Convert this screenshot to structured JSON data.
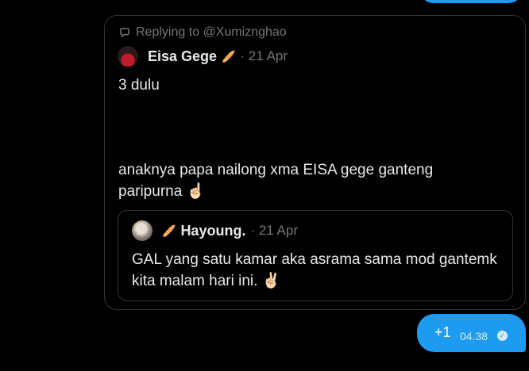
{
  "shared_post": {
    "replying_to": "Replying to @Xumiznghao",
    "author": {
      "name": "Eisa Gege",
      "badge_emoji": "🥖",
      "date": "· 21 Apr"
    },
    "text_line1": "3 dulu",
    "text_line2": " anaknya papa nailong xma EISA gege ganteng paripurna ☝🏻",
    "quoted_post": {
      "badge_emoji": "🥖",
      "author_name": "Hayoung.",
      "date": "· 21 Apr",
      "text": "GAL yang satu kamar aka asrama sama mod gantemk kita malam hari ini. ✌🏻"
    }
  },
  "message": {
    "text": "+1",
    "time": "04.38",
    "status_icon": "read-check-icon"
  },
  "colors": {
    "accent": "#1d9bf0",
    "border": "#2f3336",
    "muted": "#71767b",
    "text": "#e7e9ea",
    "background": "#000000"
  }
}
